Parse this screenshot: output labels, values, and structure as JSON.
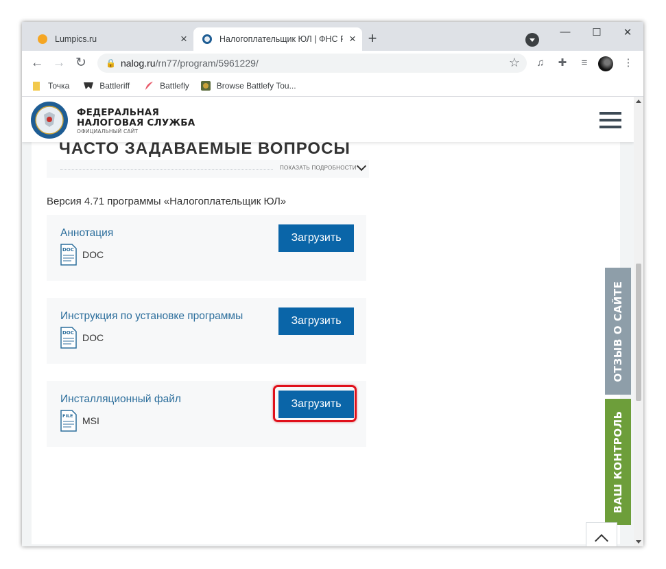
{
  "browser": {
    "tabs": [
      {
        "title": "Lumpics.ru",
        "active": false
      },
      {
        "title": "Налогоплательщик ЮЛ | ФНС Р",
        "active": true
      }
    ],
    "new_tab_label": "+",
    "url_host": "nalog.ru",
    "url_path": "/rn77/program/5961229/",
    "bookmarks": [
      "Точка",
      "Battleriff",
      "Battlefly",
      "Browse Battlefy Tou..."
    ]
  },
  "site": {
    "brand_line1": "ФЕДЕРАЛЬНАЯ",
    "brand_line2": "НАЛОГОВАЯ СЛУЖБА",
    "brand_sub": "ОФИЦИАЛЬНЫЙ САЙТ"
  },
  "page": {
    "faq_heading": "ЧАСТО ЗАДАВАЕМЫЕ ВОПРОСЫ",
    "details_label": "ПОКАЗАТЬ ПОДРОБНОСТИ",
    "version_text": "Версия 4.71 программы «Налогоплательщик ЮЛ»",
    "download_label": "Загрузить",
    "files": [
      {
        "name": "Аннотация",
        "icon_text": "DOC",
        "type": "DOC"
      },
      {
        "name": "Инструкция по установке программы",
        "icon_text": "DOC",
        "type": "DOC"
      },
      {
        "name": "Инсталляционный файл",
        "icon_text": "FILE",
        "type": "MSI"
      }
    ]
  },
  "side_tabs": {
    "feedback": "ОТЗЫВ О САЙТЕ",
    "control": "ВАШ КОНТРОЛЬ"
  },
  "colors": {
    "button_blue": "#0a65a8",
    "link_blue": "#2c6e9c",
    "feedback_gray": "#8e9ea9",
    "control_green": "#6d9e3a",
    "highlight_red": "#e0101b"
  }
}
